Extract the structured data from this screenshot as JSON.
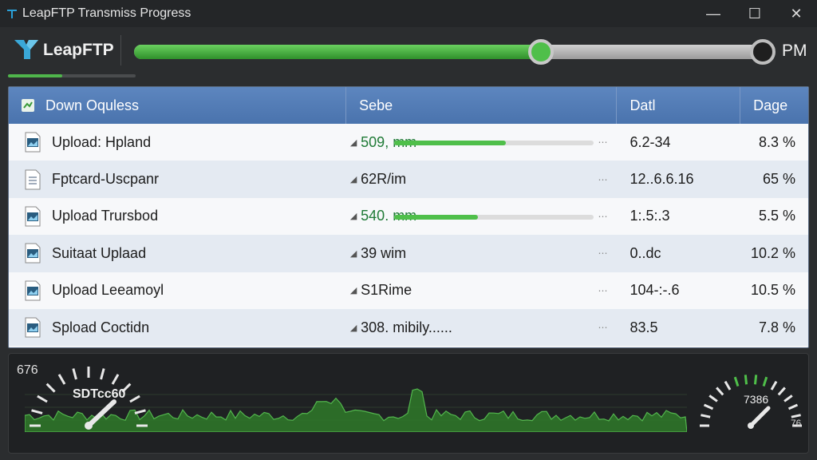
{
  "window": {
    "title": "LeapFTP Transmiss Progress",
    "controls": {
      "minimize": "—",
      "maximize": "☐",
      "close": "✕"
    }
  },
  "brand": {
    "name": "LeapFTP"
  },
  "transfer": {
    "progress_percent": 65,
    "end_label": "PM"
  },
  "table": {
    "headers": {
      "name": "Down Oquless",
      "size": "Sebe",
      "date": "Datl",
      "pct": "Dage"
    },
    "rows": [
      {
        "name": "Upload: Hpland",
        "size": "509, mm",
        "date": "6.2-34",
        "pct": "8.3 %",
        "bar": 0.56,
        "icon": "image-file-icon"
      },
      {
        "name": "Fptcard-Uscpanr",
        "size": "62R/im",
        "date": "12..6.6.16",
        "pct": "65 %",
        "bar": null,
        "icon": "text-file-icon"
      },
      {
        "name": "Upload Trursbod",
        "size": "540. mm",
        "date": "1:.5:.3",
        "pct": "5.5 %",
        "bar": 0.42,
        "icon": "image-file-icon"
      },
      {
        "name": "Suitaat Uplaad",
        "size": "39 wim",
        "date": "0..dc",
        "pct": "10.2 %",
        "bar": null,
        "icon": "image-file-icon"
      },
      {
        "name": "Upload Leeamoyl",
        "size": "S1Rime",
        "date": "104-:-.6",
        "pct": "10.5 %",
        "bar": null,
        "icon": "image-file-icon"
      },
      {
        "name": "Spload Coctidn",
        "size": "308. mibily......",
        "date": "83.5",
        "pct": "7.8 %",
        "bar": null,
        "icon": "image-file-icon"
      }
    ]
  },
  "stats": {
    "label": "676",
    "left_gauge": "SDTcc60",
    "right_gauge": "7386",
    "right_unit": "76"
  },
  "colors": {
    "accent_green": "#4fbf4a",
    "header_blue": "#4f79b3",
    "background": "#2b2d2f"
  }
}
